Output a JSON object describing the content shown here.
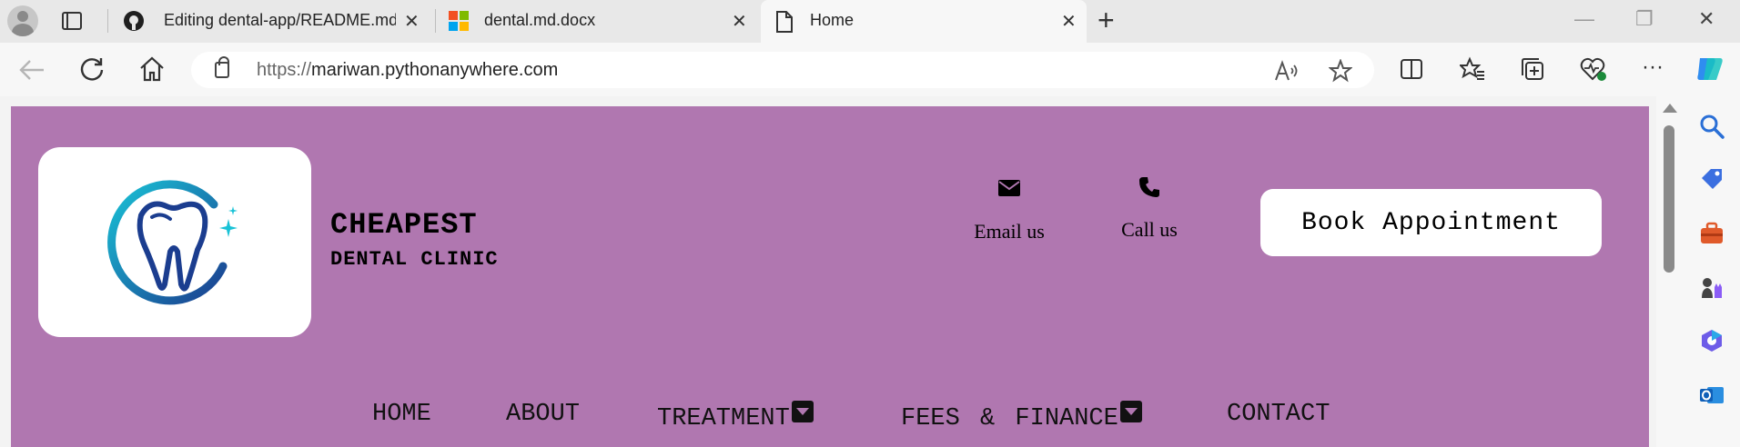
{
  "browser": {
    "tabs": [
      {
        "title": "Editing dental-app/README.md",
        "icon": "github-icon"
      },
      {
        "title": "dental.md.docx",
        "icon": "word-icon"
      },
      {
        "title": "Home",
        "icon": "page-icon"
      }
    ],
    "new_tab_glyph": "+",
    "close_glyph": "✕",
    "window_controls": {
      "minimize": "—",
      "restore": "❐",
      "close": "✕"
    },
    "url_protocol": "https://",
    "url_host": "mariwan.pythonanywhere.com"
  },
  "site": {
    "brand_line1": "CHEAPEST",
    "brand_line2": "DENTAL CLINIC",
    "email_label": "Email us",
    "call_label": "Call us",
    "book_button": "Book Appointment",
    "menu": [
      {
        "label": "HOME"
      },
      {
        "label": "ABOUT"
      },
      {
        "label": "TREATMENT"
      },
      {
        "label": "FEES & FINANCE"
      },
      {
        "label": "CONTACT"
      }
    ],
    "colors": {
      "header_bg": "#b077b0",
      "logo_blue": "#1b3d8f",
      "logo_cyan": "#19c2d6"
    }
  }
}
